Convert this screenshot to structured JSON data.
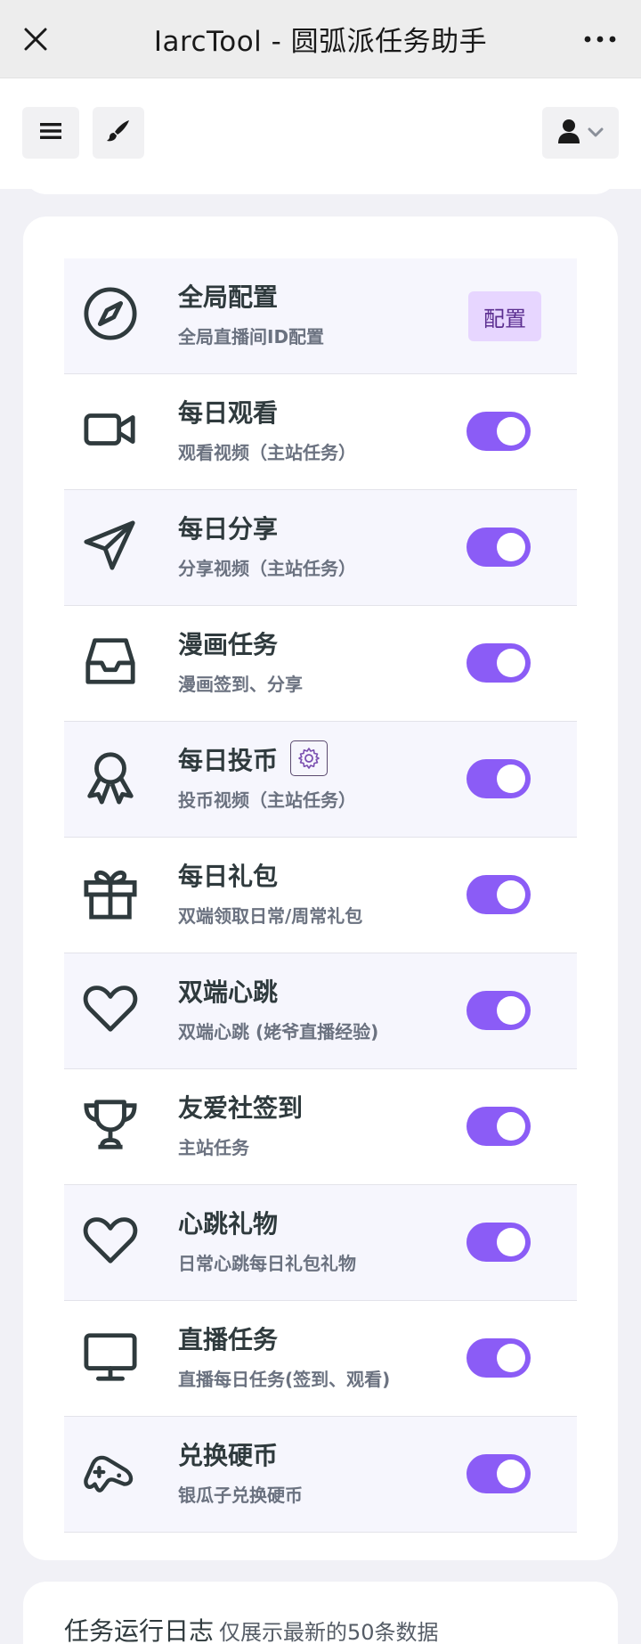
{
  "window": {
    "title": "IarcTool - 圆弧派任务助手",
    "close_icon": "close-icon",
    "more_icon": "more-icon"
  },
  "navbar": {
    "menu_icon": "hamburger-menu-icon",
    "theme_icon": "brush-icon",
    "user_icon": "user-icon",
    "dropdown_icon": "chevron-down-icon"
  },
  "colors": {
    "accent": "#8b5cf6",
    "config_bg": "#e7d6ff",
    "config_text": "#5b2e90",
    "icon": "#2f3a3d"
  },
  "tasks": [
    {
      "name": "全局配置",
      "desc": "全局直播间ID配置",
      "icon": "compass-icon",
      "control": "button",
      "button_label": "配置"
    },
    {
      "name": "每日观看",
      "desc": "观看视频（主站任务）",
      "icon": "video-camera-icon",
      "control": "toggle",
      "enabled": true
    },
    {
      "name": "每日分享",
      "desc": "分享视频（主站任务）",
      "icon": "paper-plane-icon",
      "control": "toggle",
      "enabled": true
    },
    {
      "name": "漫画任务",
      "desc": "漫画签到、分享",
      "icon": "inbox-icon",
      "control": "toggle",
      "enabled": true
    },
    {
      "name": "每日投币",
      "desc": "投币视频（主站任务）",
      "icon": "award-ribbon-icon",
      "control": "toggle",
      "enabled": true,
      "has_settings": true
    },
    {
      "name": "每日礼包",
      "desc": "双端领取日常/周常礼包",
      "icon": "gift-icon",
      "control": "toggle",
      "enabled": true
    },
    {
      "name": "双端心跳",
      "desc": "双端心跳 (姥爷直播经验)",
      "icon": "heart-icon",
      "control": "toggle",
      "enabled": true
    },
    {
      "name": "友爱社签到",
      "desc": "主站任务",
      "icon": "trophy-icon",
      "control": "toggle",
      "enabled": true
    },
    {
      "name": "心跳礼物",
      "desc": "日常心跳每日礼包礼物",
      "icon": "heart-icon",
      "control": "toggle",
      "enabled": true
    },
    {
      "name": "直播任务",
      "desc": "直播每日任务(签到、观看)",
      "icon": "monitor-icon",
      "control": "toggle",
      "enabled": true
    },
    {
      "name": "兑换硬币",
      "desc": "银瓜子兑换硬币",
      "icon": "gamepad-icon",
      "control": "toggle",
      "enabled": true
    }
  ],
  "log": {
    "title": "任务运行日志",
    "subtitle": "仅展示最新的50条数据"
  }
}
